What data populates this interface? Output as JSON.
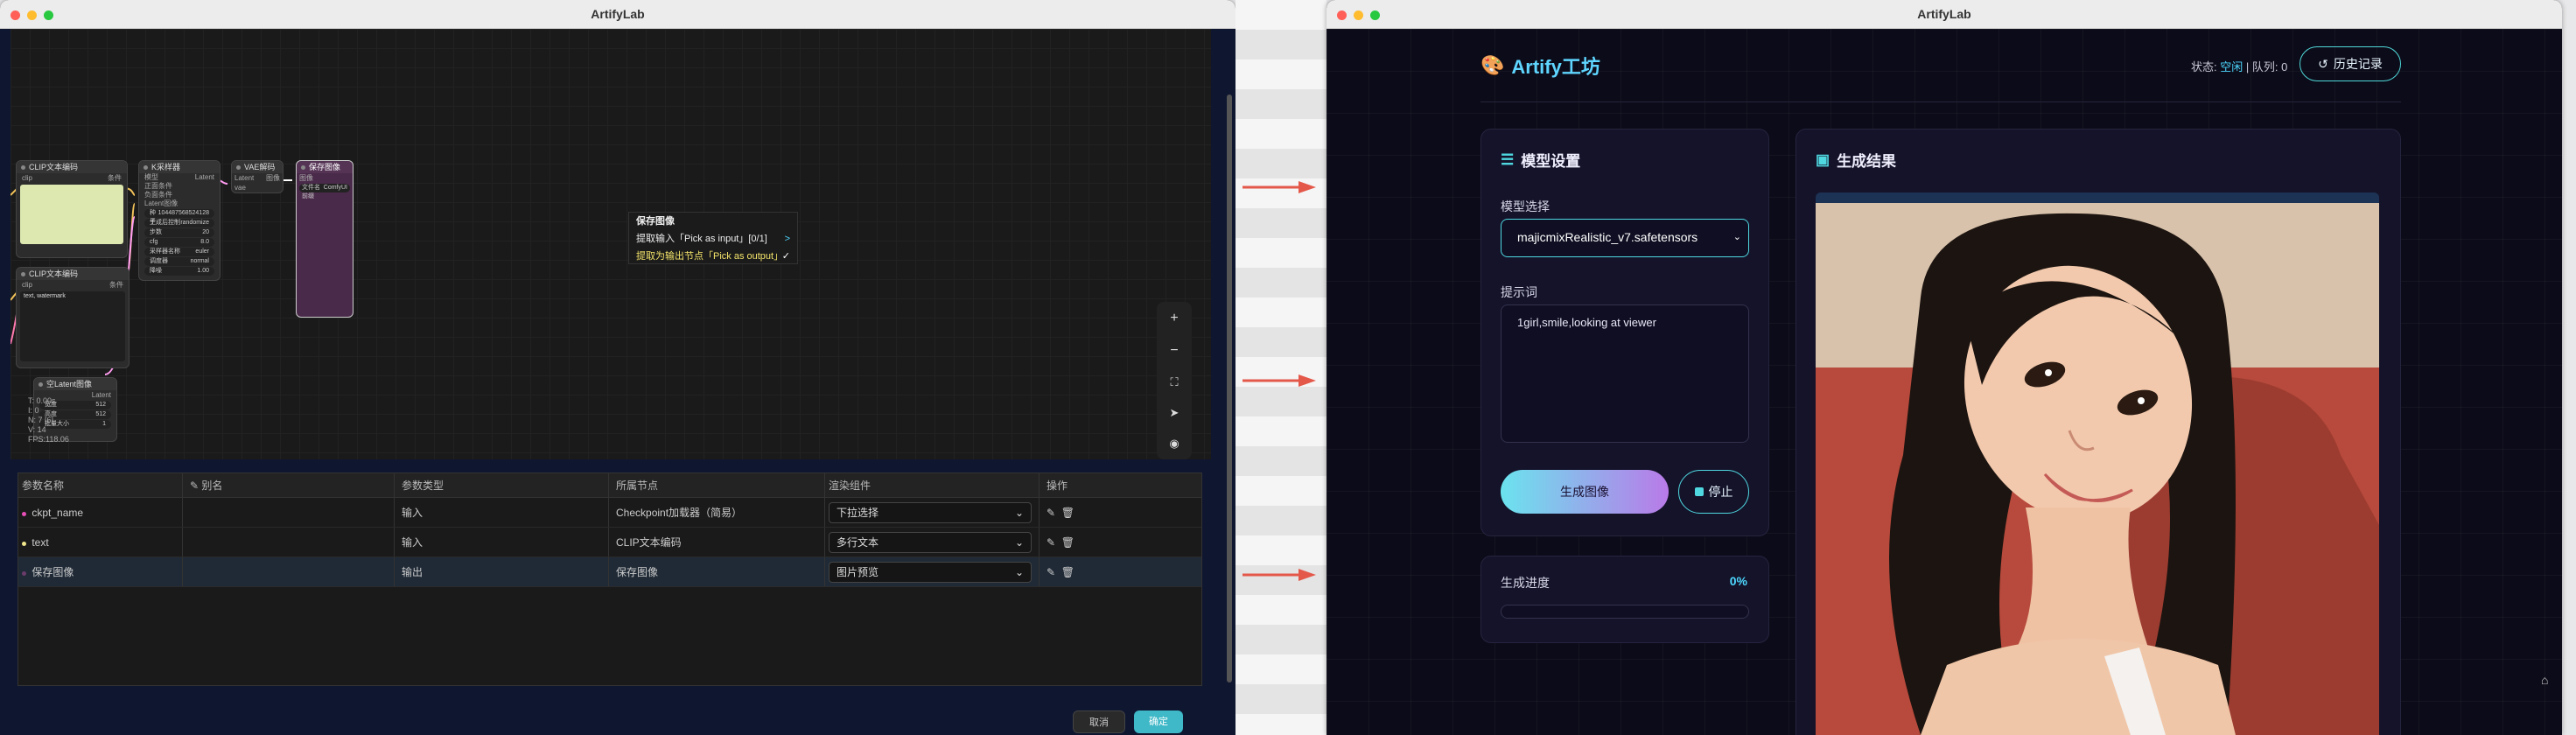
{
  "left_window": {
    "title": "ArtifyLab",
    "nodes": {
      "clip1": {
        "title": "CLIP文本编码",
        "input": "clip",
        "output": "条件"
      },
      "ksampler": {
        "title": "K采样器",
        "inputs": [
          "模型",
          "正面条件",
          "负面条件",
          "Latent图像"
        ],
        "output": "Latent",
        "widgets": [
          [
            "种子",
            "104487568524128"
          ],
          [
            "生成后控制",
            "randomize"
          ],
          [
            "步数",
            "20"
          ],
          [
            "cfg",
            "8.0"
          ],
          [
            "采样器名称",
            "euler"
          ],
          [
            "调度器",
            "normal"
          ],
          [
            "降噪",
            "1.00"
          ]
        ]
      },
      "vae": {
        "title": "VAE解码",
        "inputs": [
          "Latent",
          "vae"
        ],
        "output": "图像"
      },
      "save": {
        "title": "保存图像",
        "input": "图像",
        "prefix_label": "文件名前缀",
        "prefix_value": "ComfyUI"
      },
      "clip2": {
        "title": "CLIP文本编码",
        "input": "clip",
        "output": "条件",
        "text": "text, watermark"
      },
      "latent": {
        "title": "空Latent图像",
        "output": "Latent",
        "widgets": [
          [
            "宽度",
            "512"
          ],
          [
            "高度",
            "512"
          ],
          [
            "批量大小",
            "1"
          ]
        ]
      }
    },
    "context_menu": {
      "title": "保存图像",
      "item1": "提取输入「Pick as input」[0/1]",
      "item1_suffix": ">",
      "item2": "提取为输出节点「Pick as output」",
      "item2_suffix": "✓"
    },
    "stats": [
      "T: 0.00s",
      "I: 0",
      "N: 7 [6]",
      "V: 14",
      "FPS:118.06"
    ],
    "table": {
      "headers": [
        "参数名称",
        "别名",
        "参数类型",
        "所属节点",
        "渲染组件",
        "操作"
      ],
      "rows": [
        {
          "name": "ckpt_name",
          "alias": "",
          "type": "输入",
          "node": "Checkpoint加载器（简易）",
          "widget": "下拉选择",
          "dot": "#e64fb5"
        },
        {
          "name": "text",
          "alias": "",
          "type": "输入",
          "node": "CLIP文本编码",
          "widget": "多行文本",
          "dot": "#f0e68c"
        },
        {
          "name": "保存图像",
          "alias": "",
          "type": "输出",
          "node": "保存图像",
          "widget": "图片预览",
          "dot": "#6b3b6b"
        }
      ]
    },
    "bottom_buttons": [
      "取消",
      "确定"
    ]
  },
  "right_window": {
    "title": "ArtifyLab",
    "brand": "Artify工坊",
    "status_prefix": "状态:",
    "status_value": "空闲",
    "queue": "| 队列: 0",
    "history_button": "历史记录",
    "settings": {
      "title": "模型设置",
      "model_label": "模型选择",
      "model_value": "majicmixRealistic_v7.safetensors",
      "prompt_label": "提示词",
      "prompt_value": "1girl,smile,looking at viewer",
      "generate_button": "生成图像",
      "stop_button": "停止"
    },
    "progress": {
      "label": "生成进度",
      "value": "0%",
      "fraction": 0
    },
    "result": {
      "title": "生成结果"
    }
  },
  "colors": {
    "accent": "#4fd8e0",
    "brand": "#5fd6ff",
    "arrow": "#e4584a"
  }
}
